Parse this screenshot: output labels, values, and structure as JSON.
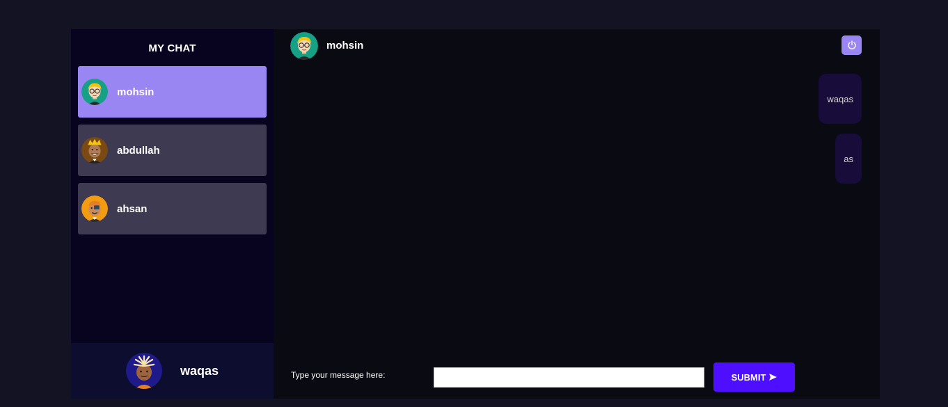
{
  "sidebar": {
    "brand": "MY CHAT",
    "contacts": [
      {
        "name": "mohsin",
        "selected": true,
        "avatar": "avatar-glasses-blonde"
      },
      {
        "name": "abdullah",
        "selected": false,
        "avatar": "avatar-crown"
      },
      {
        "name": "ahsan",
        "selected": false,
        "avatar": "avatar-eyepatch"
      }
    ],
    "current_user": {
      "name": "waqas",
      "avatar": "avatar-dreadlocks"
    }
  },
  "chat": {
    "header": {
      "name": "mohsin",
      "avatar": "avatar-glasses-blonde"
    },
    "logout_icon": "power-icon",
    "messages": [
      {
        "text": "waqas",
        "sender": "self"
      },
      {
        "text": "as",
        "sender": "self"
      }
    ],
    "input": {
      "label": "Type your message here:",
      "value": "",
      "placeholder": ""
    },
    "submit_label": "SUBMIT",
    "submit_icon": "send-icon"
  },
  "colors": {
    "background": "#131324",
    "sidebar": "#080420",
    "contact": "#3d3a52",
    "selected": "#9a86f3",
    "accent": "#4e0eff",
    "message_bubble": "#170c3a"
  }
}
